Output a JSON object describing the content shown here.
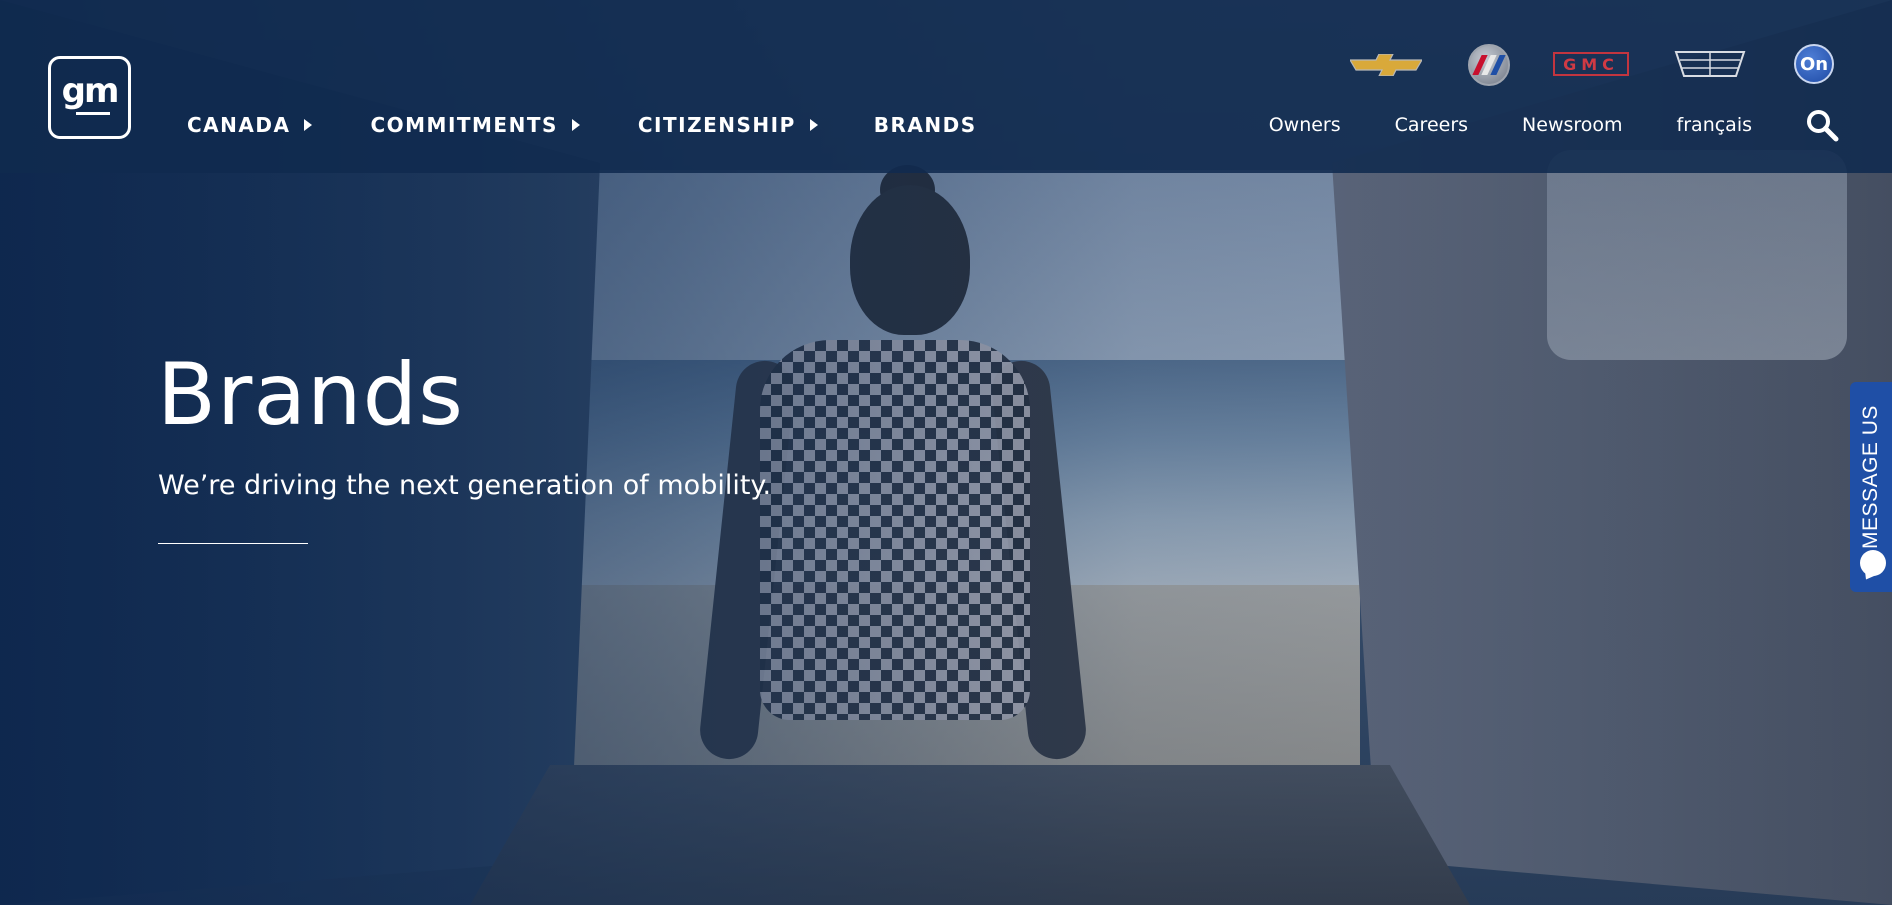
{
  "header": {
    "logo_text": "gm",
    "main_nav": [
      {
        "label": "CANADA",
        "has_submenu": true
      },
      {
        "label": "COMMITMENTS",
        "has_submenu": true
      },
      {
        "label": "CITIZENSHIP",
        "has_submenu": true
      },
      {
        "label": "BRANDS",
        "has_submenu": false
      }
    ],
    "utility_nav": [
      "Owners",
      "Careers",
      "Newsroom",
      "français"
    ],
    "search_icon": "search-icon",
    "brand_logos": {
      "chevrolet": "chevrolet-logo",
      "buick": "buick-logo",
      "gmc": "GMC",
      "cadillac": "cadillac-logo",
      "onstar": "On"
    }
  },
  "hero": {
    "title": "Brands",
    "subtitle": "We’re driving the next generation of mobility."
  },
  "message_tab": {
    "label": "MESSAGE US",
    "icon": "chat-bubble-icon"
  },
  "colors": {
    "header_bg": "#102a4e",
    "message_tab_bg": "#1f4fa6",
    "gmc_red": "#d03a44",
    "chevrolet_gold": "#d9a93a"
  }
}
